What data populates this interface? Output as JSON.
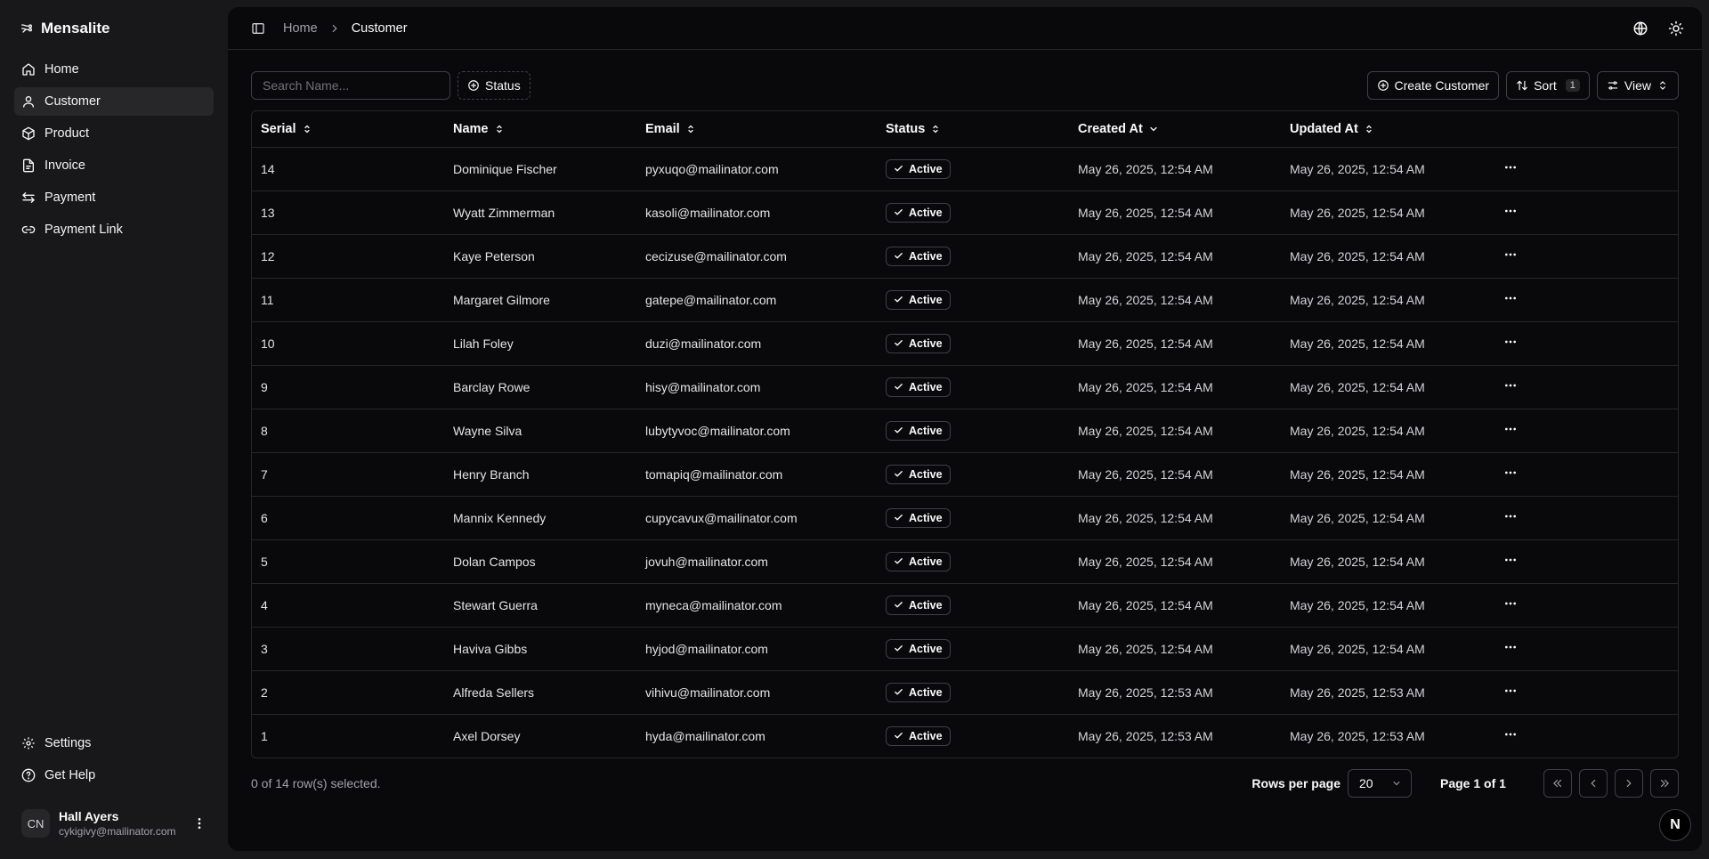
{
  "app": {
    "name": "Mensalite"
  },
  "sidebar": {
    "items": [
      {
        "label": "Home",
        "icon": "home-icon"
      },
      {
        "label": "Customer",
        "icon": "user-icon"
      },
      {
        "label": "Product",
        "icon": "package-icon"
      },
      {
        "label": "Invoice",
        "icon": "file-text-icon"
      },
      {
        "label": "Payment",
        "icon": "arrows-left-right-icon"
      },
      {
        "label": "Payment Link",
        "icon": "link-icon"
      }
    ],
    "active": "Customer",
    "bottom_items": [
      {
        "label": "Settings",
        "icon": "gear-icon"
      },
      {
        "label": "Get Help",
        "icon": "help-circle-icon"
      }
    ],
    "user": {
      "initials": "CN",
      "name": "Hall Ayers",
      "email": "cykigivy@mailinator.com"
    }
  },
  "breadcrumb": {
    "home": "Home",
    "current": "Customer"
  },
  "toolbar": {
    "search_placeholder": "Search Name...",
    "status_label": "Status",
    "create_label": "Create Customer",
    "sort_label": "Sort",
    "sort_count": "1",
    "view_label": "View"
  },
  "table": {
    "headers": {
      "serial": "Serial",
      "name": "Name",
      "email": "Email",
      "status": "Status",
      "created": "Created At",
      "updated": "Updated At"
    },
    "rows": [
      {
        "serial": "14",
        "name": "Dominique Fischer",
        "email": "pyxuqo@mailinator.com",
        "status": "Active",
        "created": "May 26, 2025, 12:54 AM",
        "updated": "May 26, 2025, 12:54 AM"
      },
      {
        "serial": "13",
        "name": "Wyatt Zimmerman",
        "email": "kasoli@mailinator.com",
        "status": "Active",
        "created": "May 26, 2025, 12:54 AM",
        "updated": "May 26, 2025, 12:54 AM"
      },
      {
        "serial": "12",
        "name": "Kaye Peterson",
        "email": "cecizuse@mailinator.com",
        "status": "Active",
        "created": "May 26, 2025, 12:54 AM",
        "updated": "May 26, 2025, 12:54 AM"
      },
      {
        "serial": "11",
        "name": "Margaret Gilmore",
        "email": "gatepe@mailinator.com",
        "status": "Active",
        "created": "May 26, 2025, 12:54 AM",
        "updated": "May 26, 2025, 12:54 AM"
      },
      {
        "serial": "10",
        "name": "Lilah Foley",
        "email": "duzi@mailinator.com",
        "status": "Active",
        "created": "May 26, 2025, 12:54 AM",
        "updated": "May 26, 2025, 12:54 AM"
      },
      {
        "serial": "9",
        "name": "Barclay Rowe",
        "email": "hisy@mailinator.com",
        "status": "Active",
        "created": "May 26, 2025, 12:54 AM",
        "updated": "May 26, 2025, 12:54 AM"
      },
      {
        "serial": "8",
        "name": "Wayne Silva",
        "email": "lubytyvoc@mailinator.com",
        "status": "Active",
        "created": "May 26, 2025, 12:54 AM",
        "updated": "May 26, 2025, 12:54 AM"
      },
      {
        "serial": "7",
        "name": "Henry Branch",
        "email": "tomapiq@mailinator.com",
        "status": "Active",
        "created": "May 26, 2025, 12:54 AM",
        "updated": "May 26, 2025, 12:54 AM"
      },
      {
        "serial": "6",
        "name": "Mannix Kennedy",
        "email": "cupycavux@mailinator.com",
        "status": "Active",
        "created": "May 26, 2025, 12:54 AM",
        "updated": "May 26, 2025, 12:54 AM"
      },
      {
        "serial": "5",
        "name": "Dolan Campos",
        "email": "jovuh@mailinator.com",
        "status": "Active",
        "created": "May 26, 2025, 12:54 AM",
        "updated": "May 26, 2025, 12:54 AM"
      },
      {
        "serial": "4",
        "name": "Stewart Guerra",
        "email": "myneca@mailinator.com",
        "status": "Active",
        "created": "May 26, 2025, 12:54 AM",
        "updated": "May 26, 2025, 12:54 AM"
      },
      {
        "serial": "3",
        "name": "Haviva Gibbs",
        "email": "hyjod@mailinator.com",
        "status": "Active",
        "created": "May 26, 2025, 12:54 AM",
        "updated": "May 26, 2025, 12:54 AM"
      },
      {
        "serial": "2",
        "name": "Alfreda Sellers",
        "email": "vihivu@mailinator.com",
        "status": "Active",
        "created": "May 26, 2025, 12:53 AM",
        "updated": "May 26, 2025, 12:53 AM"
      },
      {
        "serial": "1",
        "name": "Axel Dorsey",
        "email": "hyda@mailinator.com",
        "status": "Active",
        "created": "May 26, 2025, 12:53 AM",
        "updated": "May 26, 2025, 12:53 AM"
      }
    ]
  },
  "footer": {
    "selected_text": "0 of 14 row(s) selected.",
    "rows_per_page_label": "Rows per page",
    "rows_per_page_value": "20",
    "page_info": "Page 1 of 1"
  },
  "dev_badge": "N"
}
